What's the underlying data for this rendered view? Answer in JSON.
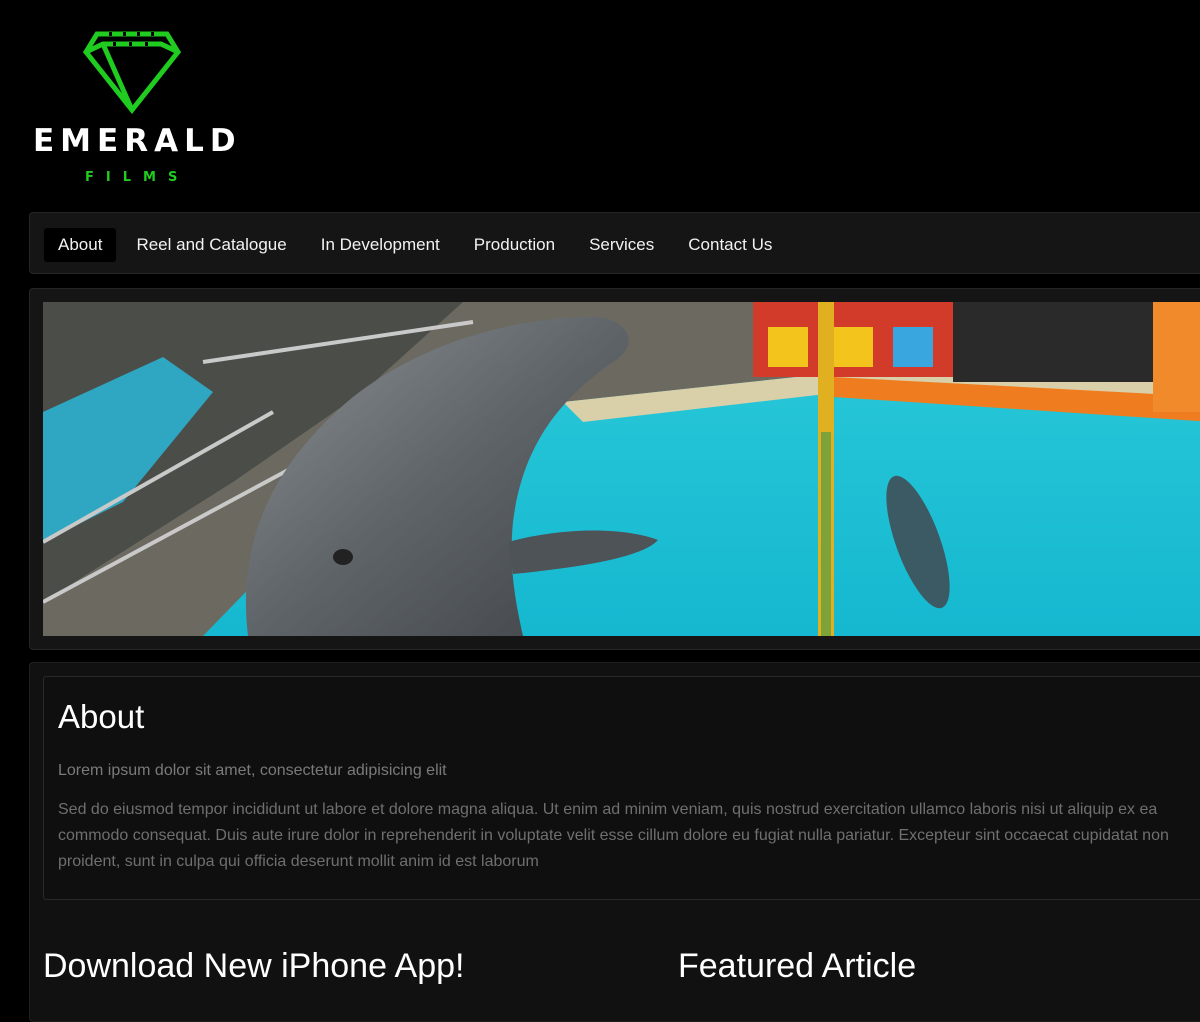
{
  "brand": {
    "name": "EMERALD",
    "subtitle": "FILMS",
    "accent_color": "#1fcc1f"
  },
  "nav": {
    "items": [
      {
        "label": "About",
        "active": true
      },
      {
        "label": "Reel and Catalogue",
        "active": false
      },
      {
        "label": "In Development",
        "active": false
      },
      {
        "label": "Production",
        "active": false
      },
      {
        "label": "Services",
        "active": false
      },
      {
        "label": "Contact Us",
        "active": false
      }
    ]
  },
  "hero": {
    "image_icon": "dolphin-photo"
  },
  "about": {
    "title": "About",
    "lead": "Lorem ipsum dolor sit amet, consectetur adipisicing elit",
    "body": "Sed do eiusmod tempor incididunt ut labore et dolore magna aliqua. Ut enim ad minim veniam, quis nostrud exercitation ullamco laboris nisi ut aliquip ex ea commodo consequat. Duis aute irure dolor in reprehenderit in voluptate velit esse cillum dolore eu fugiat nulla pariatur. Excepteur sint occaecat cupidatat non proident, sunt in culpa qui officia deserunt mollit anim id est laborum"
  },
  "sections": {
    "app_heading": "Download New iPhone App!",
    "article_heading": "Featured Article"
  }
}
